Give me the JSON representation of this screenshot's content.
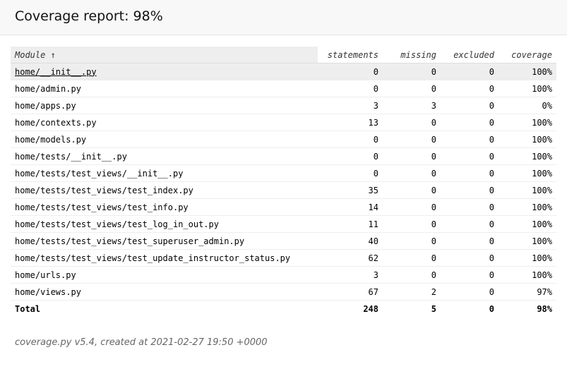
{
  "header": {
    "title": "Coverage report: 98%"
  },
  "table": {
    "columns": {
      "module": "Module",
      "sort_indicator": "↑",
      "statements": "statements",
      "missing": "missing",
      "excluded": "excluded",
      "coverage": "coverage"
    },
    "rows": [
      {
        "module": "home/__init__.py",
        "statements": "0",
        "missing": "0",
        "excluded": "0",
        "coverage": "100%"
      },
      {
        "module": "home/admin.py",
        "statements": "0",
        "missing": "0",
        "excluded": "0",
        "coverage": "100%"
      },
      {
        "module": "home/apps.py",
        "statements": "3",
        "missing": "3",
        "excluded": "0",
        "coverage": "0%"
      },
      {
        "module": "home/contexts.py",
        "statements": "13",
        "missing": "0",
        "excluded": "0",
        "coverage": "100%"
      },
      {
        "module": "home/models.py",
        "statements": "0",
        "missing": "0",
        "excluded": "0",
        "coverage": "100%"
      },
      {
        "module": "home/tests/__init__.py",
        "statements": "0",
        "missing": "0",
        "excluded": "0",
        "coverage": "100%"
      },
      {
        "module": "home/tests/test_views/__init__.py",
        "statements": "0",
        "missing": "0",
        "excluded": "0",
        "coverage": "100%"
      },
      {
        "module": "home/tests/test_views/test_index.py",
        "statements": "35",
        "missing": "0",
        "excluded": "0",
        "coverage": "100%"
      },
      {
        "module": "home/tests/test_views/test_info.py",
        "statements": "14",
        "missing": "0",
        "excluded": "0",
        "coverage": "100%"
      },
      {
        "module": "home/tests/test_views/test_log_in_out.py",
        "statements": "11",
        "missing": "0",
        "excluded": "0",
        "coverage": "100%"
      },
      {
        "module": "home/tests/test_views/test_superuser_admin.py",
        "statements": "40",
        "missing": "0",
        "excluded": "0",
        "coverage": "100%"
      },
      {
        "module": "home/tests/test_views/test_update_instructor_status.py",
        "statements": "62",
        "missing": "0",
        "excluded": "0",
        "coverage": "100%"
      },
      {
        "module": "home/urls.py",
        "statements": "3",
        "missing": "0",
        "excluded": "0",
        "coverage": "100%"
      },
      {
        "module": "home/views.py",
        "statements": "67",
        "missing": "2",
        "excluded": "0",
        "coverage": "97%"
      }
    ],
    "total": {
      "label": "Total",
      "statements": "248",
      "missing": "5",
      "excluded": "0",
      "coverage": "98%"
    }
  },
  "footer": {
    "text": "coverage.py v5.4, created at 2021-02-27 19:50 +0000"
  }
}
